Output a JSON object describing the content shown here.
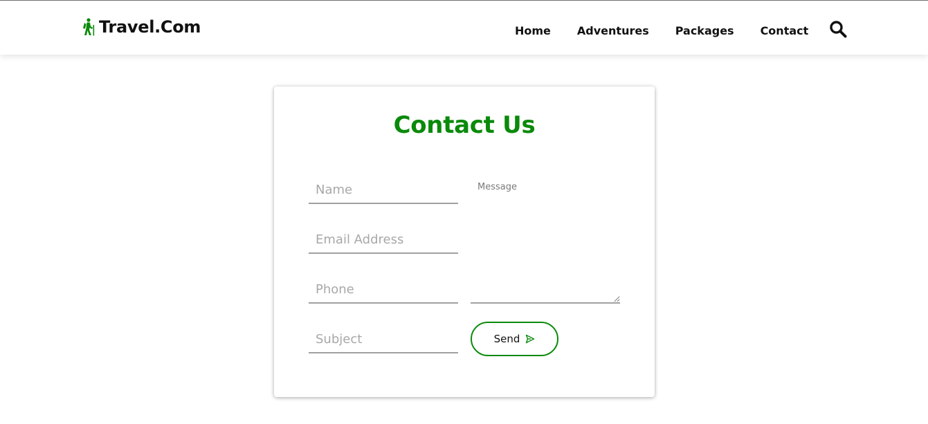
{
  "header": {
    "logo_text": "Travel.Com",
    "logo_icon": "hiker-icon",
    "nav": [
      {
        "label": "Home"
      },
      {
        "label": "Adventures"
      },
      {
        "label": "Packages"
      },
      {
        "label": "Contact"
      }
    ],
    "search_icon": "search-icon"
  },
  "contact_form": {
    "title": "Contact Us",
    "fields": {
      "name_placeholder": "Name",
      "email_placeholder": "Email Address",
      "phone_placeholder": "Phone",
      "subject_placeholder": "Subject",
      "message_placeholder": "Message"
    },
    "send_label": "Send",
    "send_icon": "paper-plane-icon"
  },
  "colors": {
    "accent": "#0a8a0a",
    "text": "#111111",
    "placeholder": "#a8a8a8",
    "underline": "#a0a0a0"
  }
}
